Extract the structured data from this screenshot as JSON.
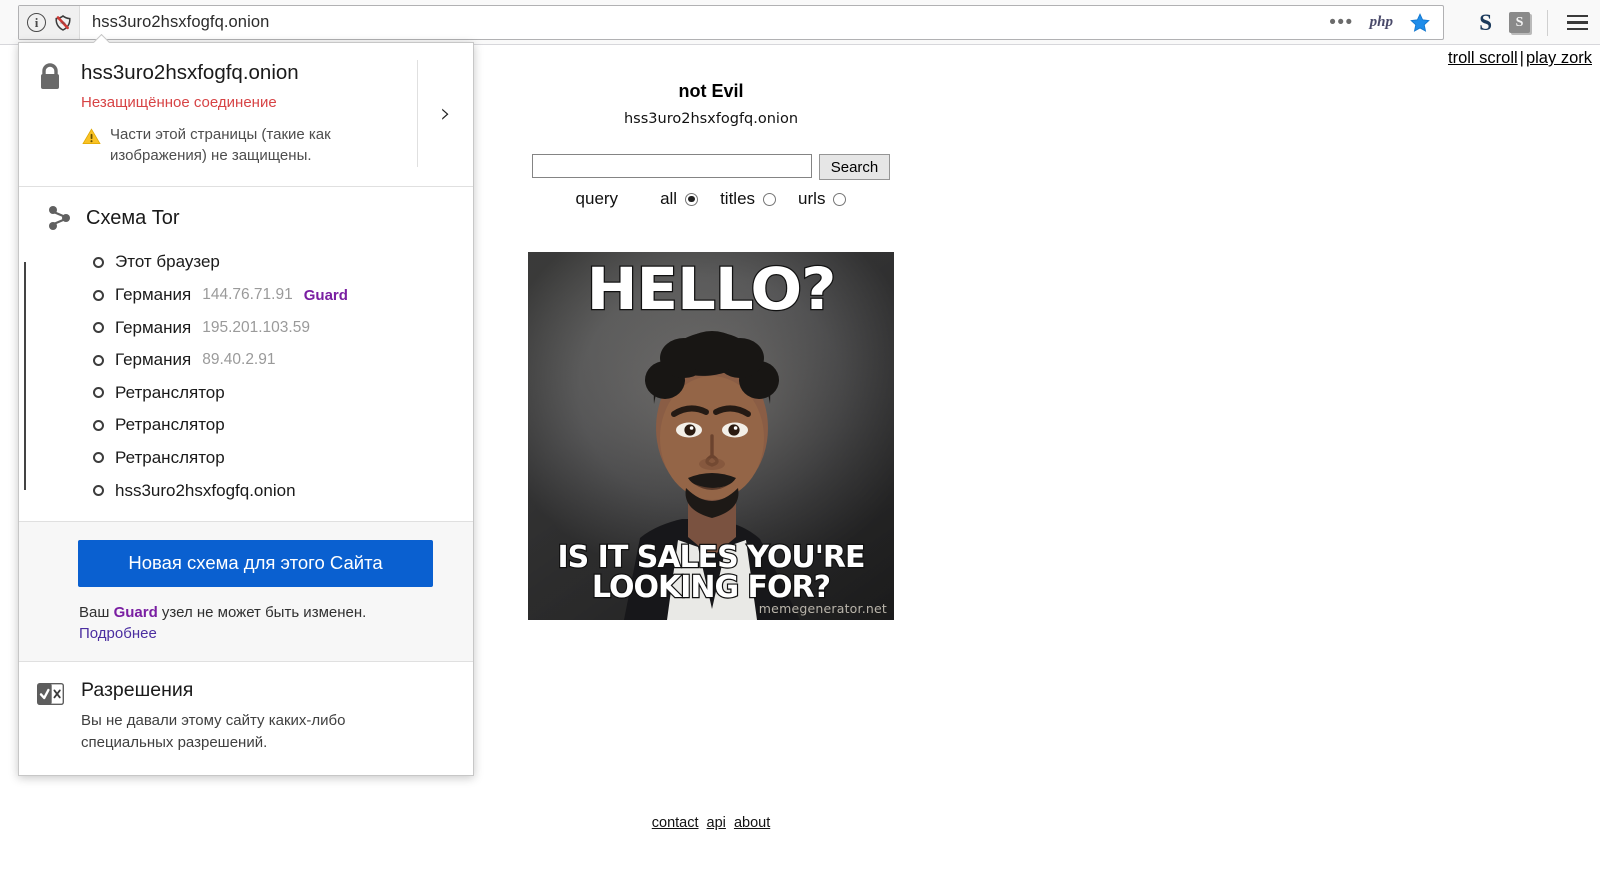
{
  "browser": {
    "url": "hss3uro2hsxfogfq.onion",
    "info_icon": "info-circle-icon",
    "mixed_content_icon": "broken-shield-icon",
    "overflow_icon": "ellipsis-icon",
    "php_icon_label": "php",
    "bookmark_icon": "star-icon",
    "ext_s_label": "S",
    "ext_sbox_label": "S",
    "menu_icon": "hamburger-icon"
  },
  "panel": {
    "identity": {
      "host": "hss3uro2hsxfogfq.onion",
      "status": "Незащищённое соединение",
      "warning": "Части этой страницы (такие как изображения) не защищены.",
      "expand_chevron": "›"
    },
    "circuit": {
      "title": "Схема Tor",
      "nodes": [
        {
          "label": "Этот браузер",
          "ip": "",
          "tag": ""
        },
        {
          "label": "Германия",
          "ip": "144.76.71.91",
          "tag": "Guard"
        },
        {
          "label": "Германия",
          "ip": "195.201.103.59",
          "tag": ""
        },
        {
          "label": "Германия",
          "ip": "89.40.2.91",
          "tag": ""
        },
        {
          "label": "Ретранслятор",
          "ip": "",
          "tag": ""
        },
        {
          "label": "Ретранслятор",
          "ip": "",
          "tag": ""
        },
        {
          "label": "Ретранслятор",
          "ip": "",
          "tag": ""
        },
        {
          "label": "hss3uro2hsxfogfq.onion",
          "ip": "",
          "tag": ""
        }
      ]
    },
    "new_circuit": {
      "button_label": "Новая схема для этого Сайта",
      "note_prefix": "Ваш ",
      "note_guard": "Guard",
      "note_suffix": " узел не может быть изменен.",
      "more_link": "Подробнее"
    },
    "permissions": {
      "title": "Разрешения",
      "text": "Вы не давали этому сайту каких-либо специальных разрешений."
    }
  },
  "page": {
    "top_links": {
      "left": "troll scroll",
      "separator": "|",
      "right": "play zork"
    },
    "site_title": "not Evil",
    "site_host": "hss3uro2hsxfogfq.onion",
    "search": {
      "value": "",
      "placeholder": "",
      "button_label": "Search",
      "query_label": "query",
      "options": [
        {
          "label": "all",
          "selected": true
        },
        {
          "label": "titles",
          "selected": false
        },
        {
          "label": "urls",
          "selected": false
        }
      ]
    },
    "meme": {
      "top_text": "HELLO?",
      "bottom_text": "IS IT SALES YOU'RE LOOKING FOR?",
      "watermark": "memegenerator.net"
    },
    "footer_links": [
      "contact",
      "api",
      "about"
    ]
  },
  "colors": {
    "accent_blue": "#0a60d0",
    "guard_purple": "#7a1fa2",
    "insecure_red": "#d74345",
    "warn_yellow": "#f9c225",
    "link_purple": "#4b2ea0"
  }
}
